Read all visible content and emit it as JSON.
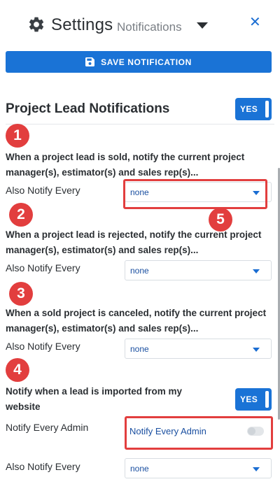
{
  "header": {
    "title": "Settings",
    "subtitle": "Notifications",
    "close_glyph": "✕",
    "icons": {
      "settings": "gear-icon",
      "menu": "caret-down-icon",
      "close": "close-icon"
    }
  },
  "toolbar": {
    "save_label": "SAVE NOTIFICATION",
    "save_icon": "floppy-disk-icon"
  },
  "section": {
    "title": "Project Lead Notifications",
    "toggle_label": "YES"
  },
  "items": [
    {
      "number": "1",
      "description": "When a project lead is sold, notify the current project manager(s), estimator(s) and sales rep(s)...",
      "label": "Also Notify Every",
      "value": "none"
    },
    {
      "number": "2",
      "description": "When a project lead is rejected, notify the current project manager(s), estimator(s) and sales rep(s)...",
      "label": "Also Notify Every",
      "value": "none"
    },
    {
      "number": "3",
      "description": "When a sold project is canceled, notify the current project manager(s), estimator(s) and sales rep(s)...",
      "label": "Also Notify Every",
      "value": "none"
    }
  ],
  "import_item": {
    "number": "4",
    "description": "Notify when a lead is imported from my website",
    "toggle_label": "YES",
    "admin_label": "Notify Every Admin",
    "admin_toggle_text": "Notify Every Admin",
    "admin_toggle_on": false,
    "also_label": "Also Notify Every",
    "also_value": "none"
  },
  "callout_5": "5",
  "colors": {
    "accent": "#1a73d6",
    "callout": "#e23e3e"
  }
}
